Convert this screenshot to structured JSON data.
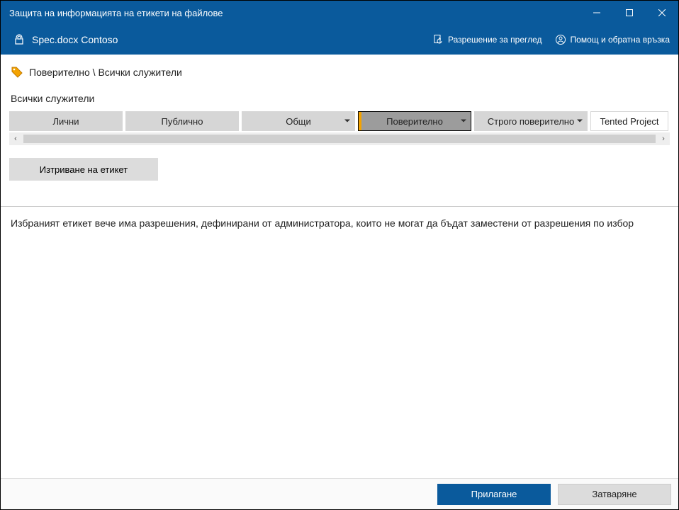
{
  "titlebar": {
    "title": "Защита на информацията на етикети на файлове"
  },
  "subheader": {
    "filename": "Spec.docx Contoso",
    "view_permission": "Разрешение за преглед",
    "help_feedback": "Помощ и обратна връзка"
  },
  "breadcrumb": "Поверително \\ Всички служители",
  "section_label": "Всички служители",
  "labels": [
    {
      "name": "Лични",
      "has_dropdown": false
    },
    {
      "name": "Публично",
      "has_dropdown": false
    },
    {
      "name": "Общи",
      "has_dropdown": true
    },
    {
      "name": "Поверително",
      "has_dropdown": true,
      "selected": true
    },
    {
      "name": "Строго поверително",
      "has_dropdown": true
    },
    {
      "name": "Tented Project",
      "has_dropdown": false,
      "last": true
    }
  ],
  "delete_label": "Изтриване на етикет",
  "admin_message": "Избраният етикет вече има разрешения, дефинирани от администратора, които не могат да бъдат заместени от разрешения по избор",
  "footer": {
    "apply": "Прилагане",
    "close": "Затваряне"
  }
}
